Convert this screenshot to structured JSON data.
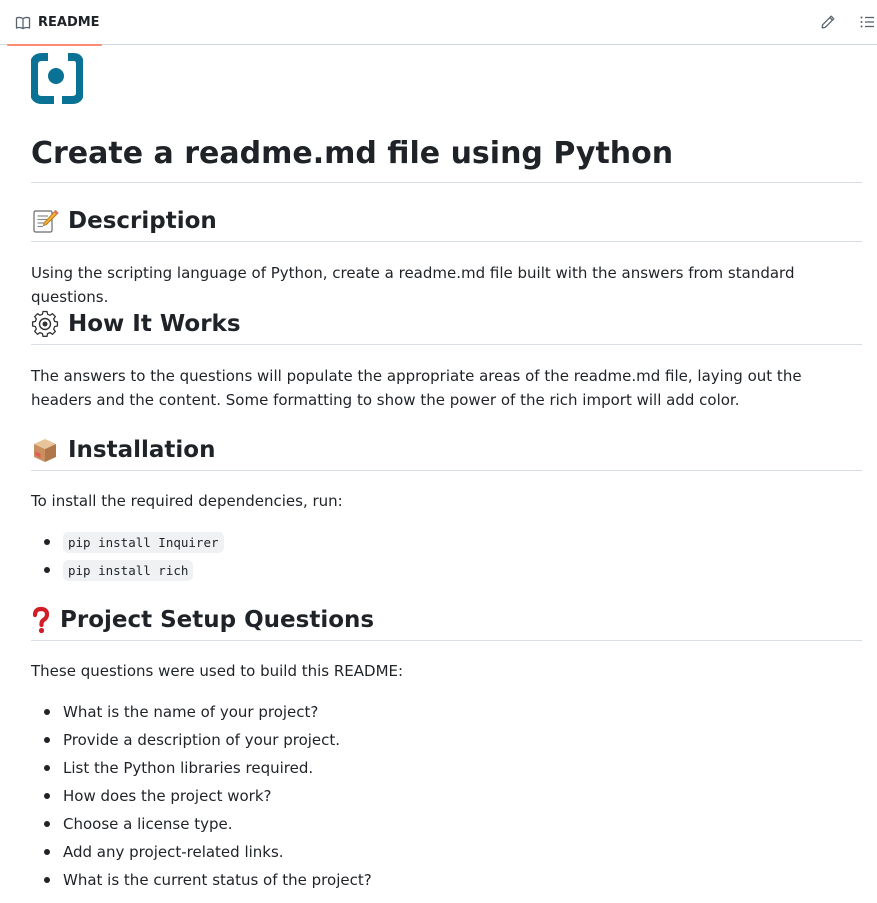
{
  "tab": {
    "label": "README",
    "icon": "book-icon"
  },
  "toolbar": {
    "edit_icon": "pencil-icon",
    "outline_icon": "list-icon"
  },
  "logo": {
    "icon": "brand-logo-icon",
    "color": "#0a7395"
  },
  "title": "Create a readme.md file using Python",
  "sections": {
    "description": {
      "emoji": "memo-icon",
      "heading": "Description",
      "text": "Using the scripting language of Python, create a readme.md file built with the answers from standard questions."
    },
    "how": {
      "emoji": "gear-icon",
      "heading": "How It Works",
      "text": "The answers to the questions will populate the appropriate areas of the readme.md file, laying out the headers and the content. Some formatting to show the power of the rich import will add color."
    },
    "installation": {
      "emoji": "package-icon",
      "heading": "Installation",
      "text": "To install the required dependencies, run:",
      "commands": [
        "pip install Inquirer",
        "pip install rich"
      ]
    },
    "questions": {
      "emoji": "question-icon",
      "heading": "Project Setup Questions",
      "text": "These questions were used to build this README:",
      "items": [
        "What is the name of your project?",
        "Provide a description of your project.",
        "List the Python libraries required.",
        "How does the project work?",
        "Choose a license type.",
        "Add any project-related links.",
        "What is the current status of the project?"
      ]
    }
  },
  "colors": {
    "tab_underline": "#fd8c73",
    "text": "#1f2328",
    "divider": "#d8dee4",
    "code_bg": "#eff1f3"
  }
}
